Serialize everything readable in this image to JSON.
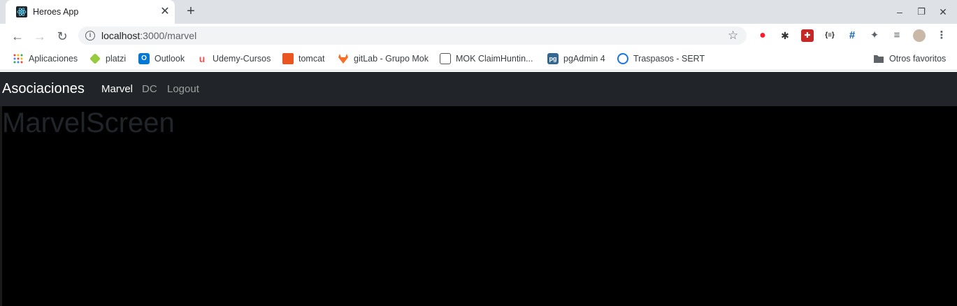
{
  "browser": {
    "tab": {
      "title": "Heroes App",
      "favicon": "react-icon"
    },
    "new_tab": "+",
    "window_controls": {
      "minimize": "–",
      "restore": "❐",
      "close": "✕"
    },
    "address": {
      "host": "localhost",
      "path": ":3000/marvel"
    },
    "extensions": [
      "opera-icon",
      "bug-icon",
      "puzzle-red-icon",
      "json-icon",
      "grid-icon",
      "extensions-icon",
      "reading-list-icon",
      "avatar"
    ],
    "bookmarks": [
      {
        "label": "Aplicaciones",
        "icon": "apps-grid-icon",
        "color": "#ea4335"
      },
      {
        "label": "platzi",
        "icon": "platzi-icon",
        "color": "#98ca3f"
      },
      {
        "label": "Outlook",
        "icon": "outlook-icon",
        "color": "#0078d4"
      },
      {
        "label": "Udemy-Cursos",
        "icon": "udemy-icon",
        "color": "#ec5252"
      },
      {
        "label": "tomcat",
        "icon": "ubuntu-icon",
        "color": "#e95420"
      },
      {
        "label": "gitLab - Grupo Mok",
        "icon": "gitlab-icon",
        "color": "#fc6d26"
      },
      {
        "label": "MOK ClaimHuntin...",
        "icon": "mok-icon",
        "color": "#555555"
      },
      {
        "label": "pgAdmin 4",
        "icon": "pgadmin-icon",
        "color": "#336791"
      },
      {
        "label": "Traspasos - SERT",
        "icon": "sert-icon",
        "color": "#1a73e8"
      }
    ],
    "other_bookmarks": "Otros favoritos"
  },
  "app": {
    "brand": "Asociaciones",
    "nav": [
      {
        "label": "Marvel",
        "active": true
      },
      {
        "label": "DC",
        "active": false
      },
      {
        "label": "Logout",
        "active": false
      }
    ],
    "page_title": "MarvelScreen"
  }
}
